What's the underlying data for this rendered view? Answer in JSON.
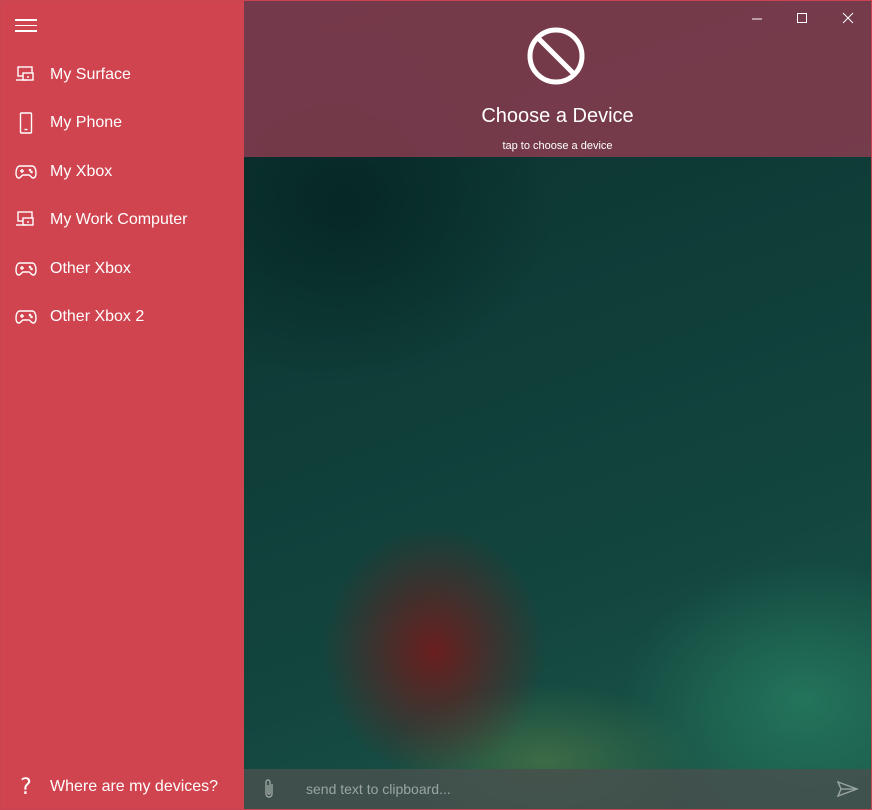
{
  "sidebar": {
    "items": [
      {
        "label": "My Surface",
        "icon": "laptop-devices-icon"
      },
      {
        "label": "My Phone",
        "icon": "phone-icon"
      },
      {
        "label": "My Xbox",
        "icon": "gamepad-icon"
      },
      {
        "label": "My Work Computer",
        "icon": "laptop-devices-icon"
      },
      {
        "label": "Other Xbox",
        "icon": "gamepad-icon"
      },
      {
        "label": "Other Xbox 2",
        "icon": "gamepad-icon"
      }
    ],
    "help_label": "Where are my devices?",
    "help_icon": "question-icon",
    "menu_icon": "hamburger-icon"
  },
  "header": {
    "title": "Choose a Device",
    "subtitle": "tap to choose a device",
    "icon": "no-device-icon"
  },
  "window_controls": {
    "minimize": "minimize-icon",
    "maximize": "maximize-icon",
    "close": "close-icon"
  },
  "composer": {
    "placeholder": "send text to clipboard...",
    "attach_icon": "paperclip-icon",
    "send_icon": "send-icon"
  },
  "colors": {
    "sidebar": "#d0444f",
    "header": "#8c3c50",
    "input_bar": "#464e4e"
  }
}
